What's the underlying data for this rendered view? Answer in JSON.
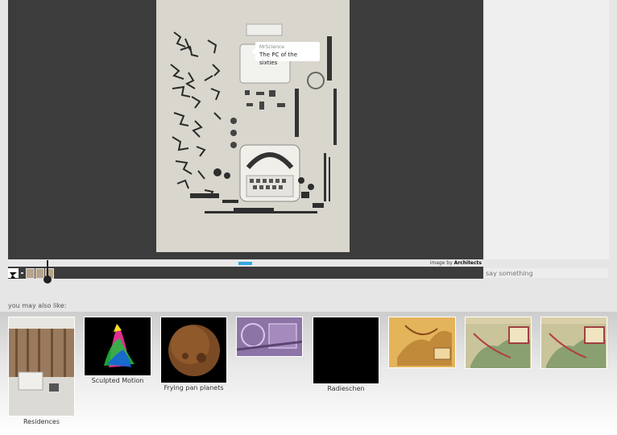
{
  "viewer": {
    "tooltip": {
      "user": "MrScience",
      "text": "The PC of the sixties"
    },
    "credit_prefix": "image by",
    "credit_author": "Architects"
  },
  "comment": {
    "placeholder": "say something"
  },
  "also": {
    "label": "you may also like:",
    "items": [
      {
        "caption": "Residences"
      },
      {
        "caption": "Sculpted Motion"
      },
      {
        "caption": "Frying pan planets"
      },
      {
        "caption": ""
      },
      {
        "caption": "Radieschen"
      },
      {
        "caption": ""
      },
      {
        "caption": ""
      },
      {
        "caption": ""
      }
    ]
  }
}
